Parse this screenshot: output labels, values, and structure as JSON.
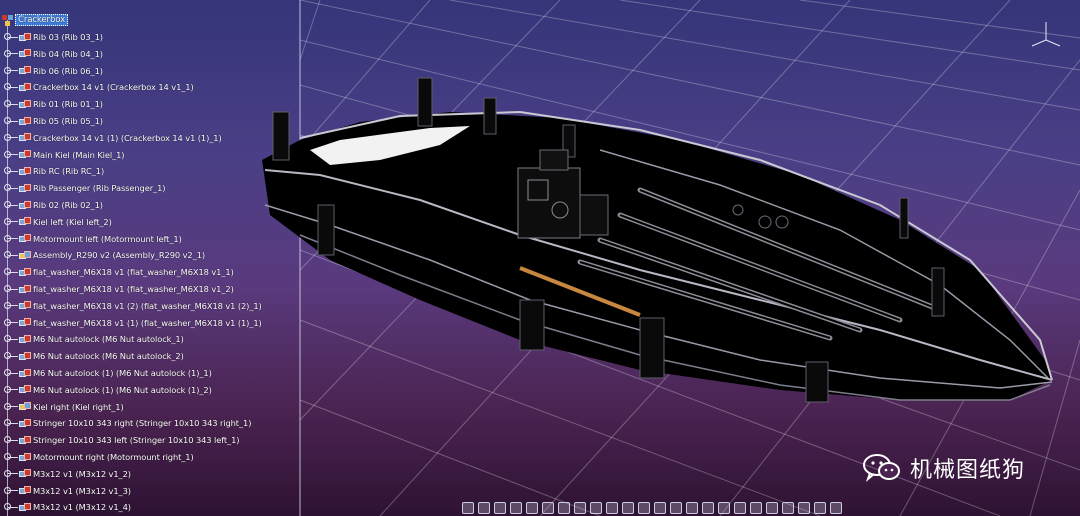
{
  "tree": {
    "root": "Crackerbox",
    "items": [
      {
        "label": "Rib 03 (Rib 03_1)",
        "type": "part"
      },
      {
        "label": "Rib 04 (Rib 04_1)",
        "type": "part"
      },
      {
        "label": "Rib 06 (Rib 06_1)",
        "type": "part"
      },
      {
        "label": "Crackerbox 14 v1 (Crackerbox 14 v1_1)",
        "type": "part"
      },
      {
        "label": "Rib 01 (Rib 01_1)",
        "type": "part"
      },
      {
        "label": "Rib 05 (Rib 05_1)",
        "type": "part"
      },
      {
        "label": "Crackerbox 14 v1 (1) (Crackerbox 14 v1 (1)_1)",
        "type": "part"
      },
      {
        "label": "Main Kiel (Main Kiel_1)",
        "type": "part"
      },
      {
        "label": "Rib RC (Rib RC_1)",
        "type": "part"
      },
      {
        "label": "Rib Passenger (Rib Passenger_1)",
        "type": "part"
      },
      {
        "label": "Rib 02 (Rib 02_1)",
        "type": "part"
      },
      {
        "label": "Kiel left (Kiel left_2)",
        "type": "part"
      },
      {
        "label": "Motormount left (Motormount left_1)",
        "type": "part"
      },
      {
        "label": "Assembly_R290 v2 (Assembly_R290 v2_1)",
        "type": "assembly"
      },
      {
        "label": "flat_washer_M6X18 v1 (flat_washer_M6X18 v1_1)",
        "type": "part"
      },
      {
        "label": "flat_washer_M6X18 v1 (flat_washer_M6X18 v1_2)",
        "type": "part"
      },
      {
        "label": "flat_washer_M6X18 v1 (2) (flat_washer_M6X18 v1 (2)_1)",
        "type": "part"
      },
      {
        "label": "flat_washer_M6X18 v1 (1) (flat_washer_M6X18 v1 (1)_1)",
        "type": "part"
      },
      {
        "label": "M6 Nut autolock (M6 Nut autolock_1)",
        "type": "part"
      },
      {
        "label": "M6 Nut autolock (M6 Nut autolock_2)",
        "type": "part"
      },
      {
        "label": "M6 Nut autolock (1) (M6 Nut autolock (1)_1)",
        "type": "part"
      },
      {
        "label": "M6 Nut autolock (1) (M6 Nut autolock (1)_2)",
        "type": "part"
      },
      {
        "label": "Kiel right (Kiel right_1)",
        "type": "assembly"
      },
      {
        "label": "Stringer 10x10 343 right (Stringer 10x10 343 right_1)",
        "type": "part"
      },
      {
        "label": "Stringer 10x10 343 left (Stringer 10x10 343 left_1)",
        "type": "part"
      },
      {
        "label": "Motormount right (Motormount right_1)",
        "type": "part"
      },
      {
        "label": "M3x12 v1 (M3x12 v1_2)",
        "type": "part"
      },
      {
        "label": "M3x12 v1 (M3x12 v1_3)",
        "type": "part"
      },
      {
        "label": "M3x12 v1 (M3x12 v1_4)",
        "type": "part"
      }
    ]
  },
  "watermark": {
    "text": "机械图纸狗",
    "icon": "wechat-icon"
  },
  "toolbar": {
    "icons": [
      "fit-all-icon",
      "pan-icon",
      "rotate-icon",
      "zoom-icon",
      "normal-view-icon",
      "multi-view-icon",
      "iso-view-icon",
      "render-style-icon",
      "hide-show-icon",
      "swap-icon",
      "measure-icon",
      "apply-material-icon",
      "section-icon",
      "snap-icon",
      "compass-icon",
      "grid-icon",
      "lighting-icon",
      "camera-icon",
      "walk-icon",
      "fly-icon",
      "sketch-icon",
      "analysis-icon",
      "properties-icon",
      "catalog-icon"
    ]
  },
  "colors": {
    "selection": "#3d7bd9",
    "background_top": "#35357a",
    "background_bottom": "#2e1233",
    "grid": "#ffffff",
    "stringer_highlight": "#c8873f"
  }
}
